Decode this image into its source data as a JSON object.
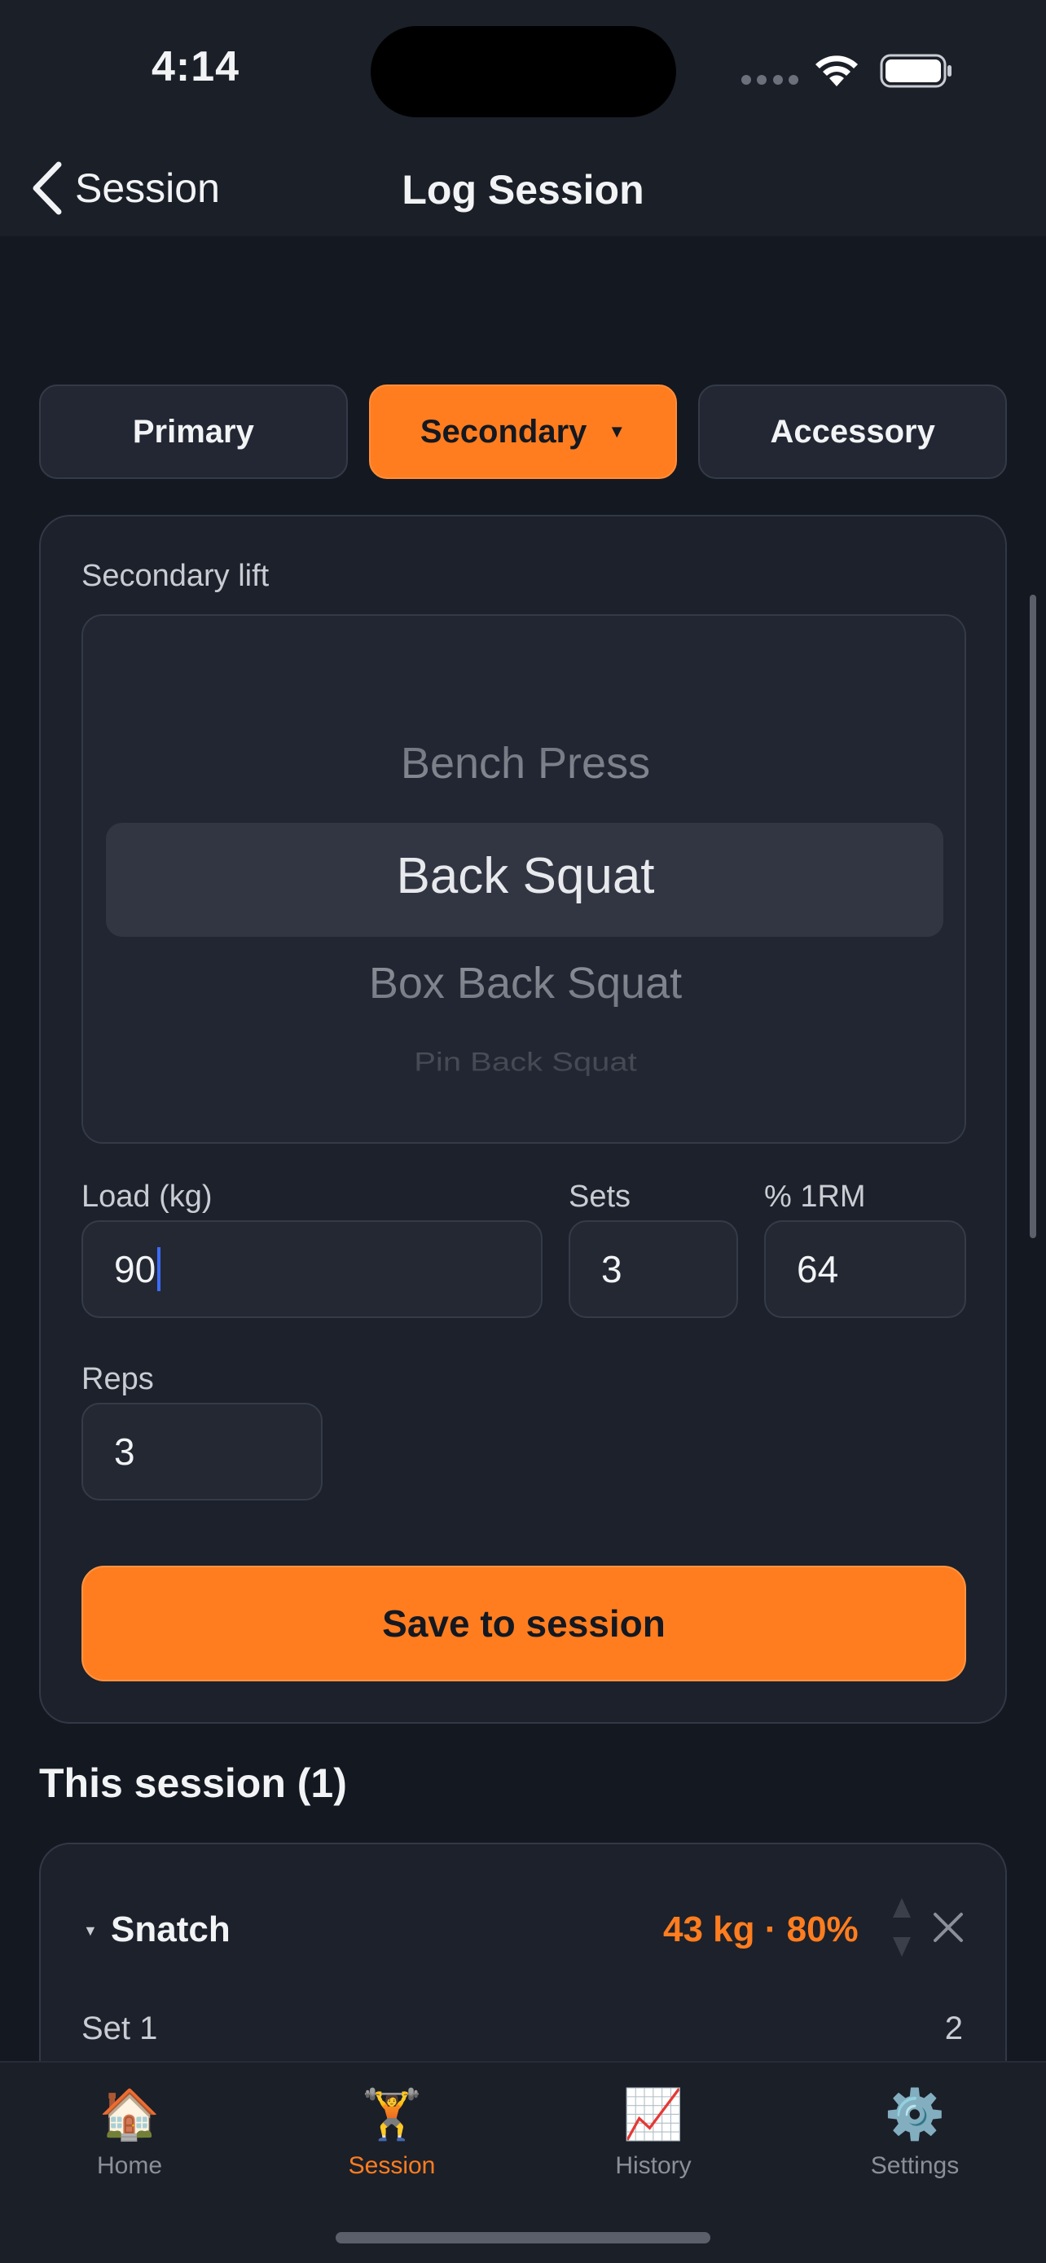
{
  "status_bar": {
    "time": "4:14"
  },
  "nav": {
    "back_label": "Session",
    "title": "Log Session"
  },
  "tabs": [
    {
      "label": "Primary",
      "active": false
    },
    {
      "label": "Secondary",
      "active": true,
      "caret": "▼"
    },
    {
      "label": "Accessory",
      "active": false
    }
  ],
  "form": {
    "lift_label": "Secondary lift",
    "picker": {
      "above": "Bench Press",
      "selected": "Back Squat",
      "below": "Box Back Squat",
      "far_below": "Pin Back Squat"
    },
    "load": {
      "label": "Load (kg)",
      "value": "90"
    },
    "sets": {
      "label": "Sets",
      "value": "3"
    },
    "percent_1rm": {
      "label": "% 1RM",
      "value": "64"
    },
    "reps": {
      "label": "Reps",
      "value": "3"
    },
    "save_label": "Save to session"
  },
  "session": {
    "title": "This session (1)",
    "entries": [
      {
        "name": "Snatch",
        "summary": "43 kg · 80%",
        "sets": [
          {
            "label": "Set 1",
            "value": "2"
          }
        ]
      }
    ]
  },
  "tab_bar": [
    {
      "label": "Home",
      "icon": "house-icon",
      "glyph": "🏠",
      "active": false
    },
    {
      "label": "Session",
      "icon": "weightlifter-icon",
      "glyph": "🏋️",
      "active": true
    },
    {
      "label": "History",
      "icon": "chart-increasing-icon",
      "glyph": "📈",
      "active": false
    },
    {
      "label": "Settings",
      "icon": "gear-icon",
      "glyph": "⚙️",
      "active": false
    }
  ],
  "colors": {
    "accent": "#ff7d1f",
    "background": "#141821",
    "card": "#1c212b",
    "cursor": "#3b6cff"
  }
}
